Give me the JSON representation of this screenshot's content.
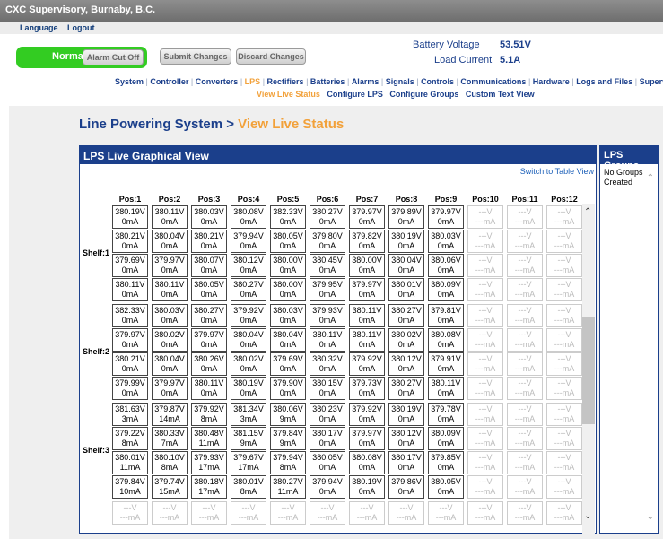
{
  "header": {
    "title": "CXC Supervisory, Burnaby, B.C.",
    "menu": [
      "Language",
      "Logout"
    ]
  },
  "status": {
    "state": "Normal",
    "alarm_cut_off": "Alarm Cut Off",
    "submit": "Submit Changes",
    "discard": "Discard Changes",
    "battery_voltage_label": "Battery Voltage",
    "battery_voltage_value": "53.51V",
    "load_current_label": "Load Current",
    "load_current_value": "5.1A",
    "colors": {
      "ok": "#33cc22",
      "accent": "#f2a13a",
      "brand": "#1b3f8b"
    }
  },
  "nav": {
    "items": [
      "System",
      "Controller",
      "Converters",
      "LPS",
      "Rectifiers",
      "Batteries",
      "Alarms",
      "Signals",
      "Controls",
      "Communications",
      "Hardware",
      "Logs and Files",
      "Supervisor"
    ],
    "active": "LPS",
    "subitems": [
      "View Live Status",
      "Configure LPS",
      "Configure Groups",
      "Custom Text View"
    ],
    "active_sub": "View Live Status"
  },
  "page": {
    "title_main": "Line Powering System >",
    "title_sub": "View Live Status"
  },
  "panel": {
    "title": "LPS Live Graphical View",
    "switch_link": "Switch to Table View",
    "positions": [
      "Pos:1",
      "Pos:2",
      "Pos:3",
      "Pos:4",
      "Pos:5",
      "Pos:6",
      "Pos:7",
      "Pos:8",
      "Pos:9",
      "Pos:10",
      "Pos:11",
      "Pos:12"
    ],
    "shelves": [
      {
        "label": "Shelf:1",
        "rows": [
          [
            "380.19V|0mA",
            "380.11V|0mA",
            "380.03V|0mA",
            "380.08V|0mA",
            "382.33V|0mA",
            "380.27V|0mA",
            "379.97V|0mA",
            "379.89V|0mA",
            "379.97V|0mA",
            "---V|---mA",
            "---V|---mA",
            "---V|---mA"
          ],
          [
            "380.21V|0mA",
            "380.04V|0mA",
            "380.21V|0mA",
            "379.94V|0mA",
            "380.05V|0mA",
            "379.80V|0mA",
            "379.82V|0mA",
            "380.19V|0mA",
            "380.03V|0mA",
            "---V|---mA",
            "---V|---mA",
            "---V|---mA"
          ],
          [
            "379.69V|0mA",
            "379.97V|0mA",
            "380.07V|0mA",
            "380.12V|0mA",
            "380.00V|0mA",
            "380.45V|0mA",
            "380.00V|0mA",
            "380.04V|0mA",
            "380.06V|0mA",
            "---V|---mA",
            "---V|---mA",
            "---V|---mA"
          ],
          [
            "380.11V|0mA",
            "380.11V|0mA",
            "380.05V|0mA",
            "380.27V|0mA",
            "380.00V|0mA",
            "379.95V|0mA",
            "379.97V|0mA",
            "380.01V|0mA",
            "380.09V|0mA",
            "---V|---mA",
            "---V|---mA",
            "---V|---mA"
          ]
        ]
      },
      {
        "label": "Shelf:2",
        "rows": [
          [
            "382.33V|0mA",
            "380.03V|0mA",
            "380.27V|0mA",
            "379.92V|0mA",
            "380.03V|0mA",
            "379.93V|0mA",
            "380.11V|0mA",
            "380.27V|0mA",
            "379.81V|0mA",
            "---V|---mA",
            "---V|---mA",
            "---V|---mA"
          ],
          [
            "379.97V|0mA",
            "380.02V|0mA",
            "379.97V|0mA",
            "380.04V|0mA",
            "380.04V|0mA",
            "380.11V|0mA",
            "380.11V|0mA",
            "380.02V|0mA",
            "380.08V|0mA",
            "---V|---mA",
            "---V|---mA",
            "---V|---mA"
          ],
          [
            "380.21V|0mA",
            "380.04V|0mA",
            "380.26V|0mA",
            "380.02V|0mA",
            "379.69V|0mA",
            "380.32V|0mA",
            "379.92V|0mA",
            "380.12V|0mA",
            "379.91V|0mA",
            "---V|---mA",
            "---V|---mA",
            "---V|---mA"
          ],
          [
            "379.99V|0mA",
            "379.97V|0mA",
            "380.11V|0mA",
            "380.19V|0mA",
            "379.90V|0mA",
            "380.15V|0mA",
            "379.73V|0mA",
            "380.27V|0mA",
            "380.11V|0mA",
            "---V|---mA",
            "---V|---mA",
            "---V|---mA"
          ]
        ]
      },
      {
        "label": "Shelf:3",
        "rows": [
          [
            "381.63V|3mA",
            "379.87V|14mA",
            "379.92V|8mA",
            "381.34V|3mA",
            "380.06V|9mA",
            "380.23V|0mA",
            "379.92V|0mA",
            "380.19V|0mA",
            "379.78V|0mA",
            "---V|---mA",
            "---V|---mA",
            "---V|---mA"
          ],
          [
            "379.22V|8mA",
            "380.33V|7mA",
            "380.48V|11mA",
            "381.15V|9mA",
            "379.84V|9mA",
            "380.17V|0mA",
            "379.97V|0mA",
            "380.12V|0mA",
            "380.09V|0mA",
            "---V|---mA",
            "---V|---mA",
            "---V|---mA"
          ],
          [
            "380.01V|11mA",
            "380.10V|8mA",
            "379.93V|17mA",
            "379.67V|17mA",
            "379.94V|8mA",
            "380.05V|0mA",
            "380.08V|0mA",
            "380.17V|0mA",
            "379.85V|0mA",
            "---V|---mA",
            "---V|---mA",
            "---V|---mA"
          ],
          [
            "379.84V|10mA",
            "379.74V|15mA",
            "380.18V|17mA",
            "380.01V|8mA",
            "380.27V|11mA",
            "379.94V|0mA",
            "380.19V|0mA",
            "379.86V|0mA",
            "380.05V|0mA",
            "---V|---mA",
            "---V|---mA",
            "---V|---mA"
          ]
        ]
      },
      {
        "label": "",
        "rows": [
          [
            "---V|---mA",
            "---V|---mA",
            "---V|---mA",
            "---V|---mA",
            "---V|---mA",
            "---V|---mA",
            "---V|---mA",
            "---V|---mA",
            "---V|---mA",
            "---V|---mA",
            "---V|---mA",
            "---V|---mA"
          ]
        ]
      }
    ]
  },
  "groups": {
    "title": "LPS Groups",
    "empty_text": "No Groups Created"
  }
}
